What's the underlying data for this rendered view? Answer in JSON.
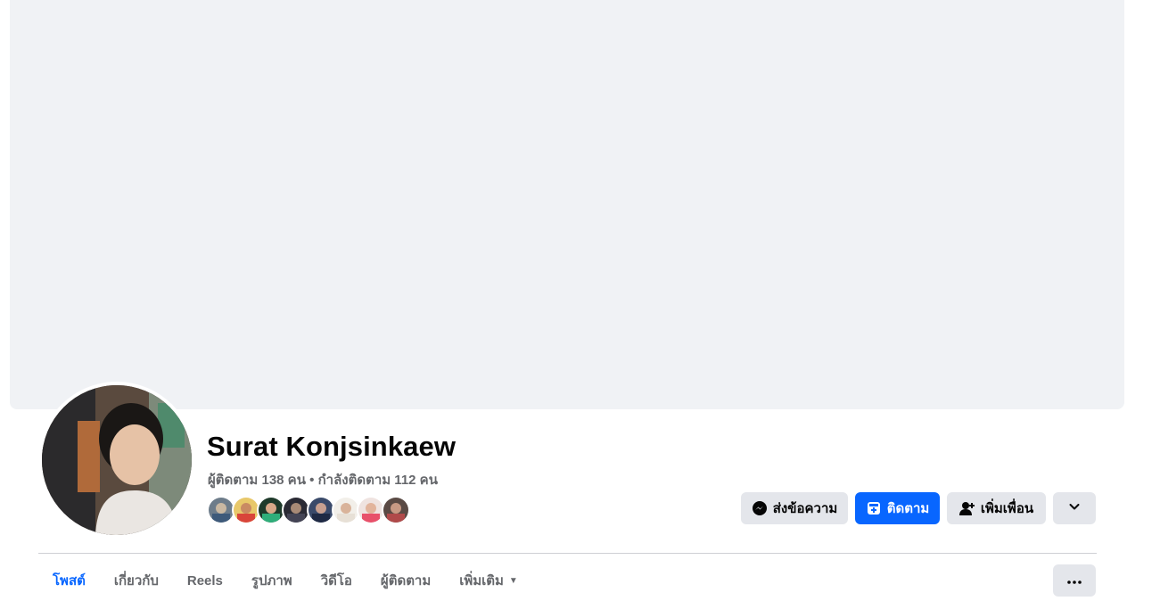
{
  "profile": {
    "name": "Surat Konjsinkaew",
    "followers": "ผู้ติดตาม 138 คน",
    "separator": " • ",
    "following": "กำลังติดตาม 112 คน"
  },
  "actions": {
    "message_label": "ส่งข้อความ",
    "follow_label": "ติดตาม",
    "add_friend_label": "เพิ่มเพื่อน",
    "expand_icon": "chevron-down-icon"
  },
  "tabs": [
    {
      "label": "โพสต์",
      "active": true
    },
    {
      "label": "เกี่ยวกับ",
      "active": false
    },
    {
      "label": "Reels",
      "active": false
    },
    {
      "label": "รูปภาพ",
      "active": false
    },
    {
      "label": "วิดีโอ",
      "active": false
    },
    {
      "label": "ผู้ติดตาม",
      "active": false
    },
    {
      "label": "เพิ่มเติม",
      "active": false
    }
  ],
  "colors": {
    "accent": "#0866ff",
    "cover": "#f0f2f5",
    "secondary_button": "#e4e6eb",
    "muted_text": "#65676b"
  },
  "icons": {
    "message": "messenger-icon",
    "follow": "follow-icon",
    "add_friend": "add-friend-icon",
    "more": "more-dots-icon",
    "tab_more": "caret-down-icon"
  },
  "friends_count_shown": 8
}
